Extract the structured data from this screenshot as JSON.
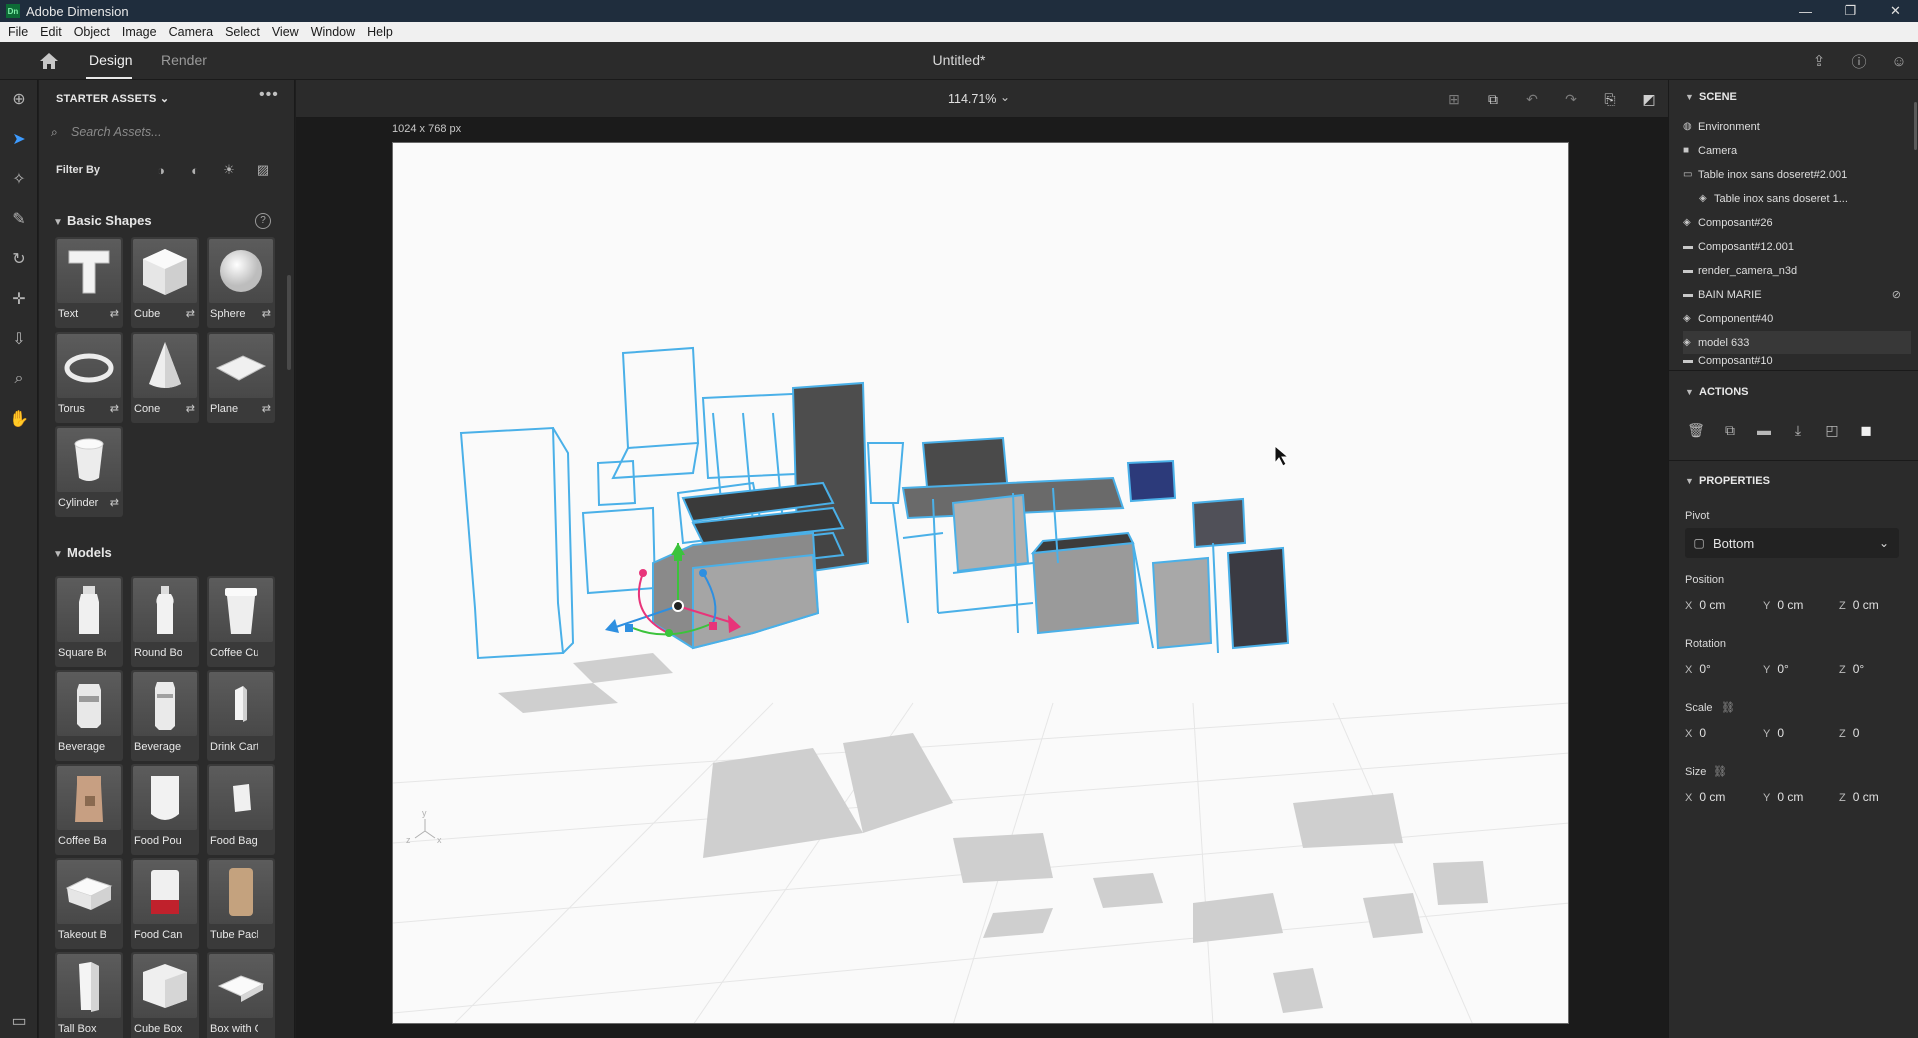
{
  "window": {
    "app_title": "Adobe Dimension",
    "logo_text": "Dn",
    "min": "—",
    "restore": "❐",
    "close": "✕"
  },
  "menu": [
    "File",
    "Edit",
    "Object",
    "Image",
    "Camera",
    "Select",
    "View",
    "Window",
    "Help"
  ],
  "header": {
    "tabs": [
      "Design",
      "Render"
    ],
    "doc_title": "Untitled*"
  },
  "left_panel": {
    "title": "STARTER ASSETS",
    "more": "•••",
    "search_placeholder": "Search Assets...",
    "filter_label": "Filter By",
    "basic_shapes": {
      "title": "Basic Shapes",
      "items": [
        "Text",
        "Cube",
        "Sphere",
        "Torus",
        "Cone",
        "Plane",
        "Cylinder"
      ]
    },
    "models": {
      "title": "Models",
      "items": [
        "Square Bo...",
        "Round Bo...",
        "Coffee Cup",
        "Beverage ...",
        "Beverage ...",
        "Drink Cart...",
        "Coffee Bag",
        "Food Pouch",
        "Food Bag",
        "Takeout Box",
        "Food Can",
        "Tube Pack...",
        "Tall Box",
        "Cube Box",
        "Box with O..."
      ]
    }
  },
  "canvas": {
    "zoom": "114.71%",
    "dims": "1024 x 768 px",
    "axis_labels": [
      "y",
      "z",
      "x"
    ]
  },
  "right_panel": {
    "scene": {
      "title": "SCENE",
      "items": [
        {
          "label": "Environment",
          "icon": "environment-icon"
        },
        {
          "label": "Camera",
          "icon": "camera-icon"
        },
        {
          "label": "Table inox sans doseret#2.001",
          "icon": "folder-icon"
        },
        {
          "label": "Table inox sans doseret 1...",
          "icon": "model-icon"
        },
        {
          "label": "Composant#26",
          "icon": "model-icon"
        },
        {
          "label": "Composant#12.001",
          "icon": "folder-icon"
        },
        {
          "label": "render_camera_n3d",
          "icon": "folder-icon"
        },
        {
          "label": "BAIN MARIE",
          "icon": "folder-icon"
        },
        {
          "label": "Component#40",
          "icon": "model-icon"
        },
        {
          "label": "model 633",
          "icon": "model-icon"
        },
        {
          "label": "Composant#10",
          "icon": "folder-icon"
        }
      ]
    },
    "actions": {
      "title": "ACTIONS"
    },
    "properties": {
      "title": "PROPERTIES",
      "pivot_label": "Pivot",
      "pivot_value": "Bottom",
      "position": {
        "label": "Position",
        "x": "0 cm",
        "y": "0 cm",
        "z": "0 cm"
      },
      "rotation": {
        "label": "Rotation",
        "x": "0°",
        "y": "0°",
        "z": "0°"
      },
      "scale": {
        "label": "Scale",
        "x": "0",
        "y": "0",
        "z": "0"
      },
      "size": {
        "label": "Size",
        "x": "0 cm",
        "y": "0 cm",
        "z": "0 cm"
      }
    }
  },
  "colors": {
    "accent": "#3d9bff",
    "outline": "#4ab0e8",
    "gizmo_red": "#e8357a",
    "gizmo_green": "#3cc33c",
    "gizmo_blue": "#2e8fe0"
  }
}
